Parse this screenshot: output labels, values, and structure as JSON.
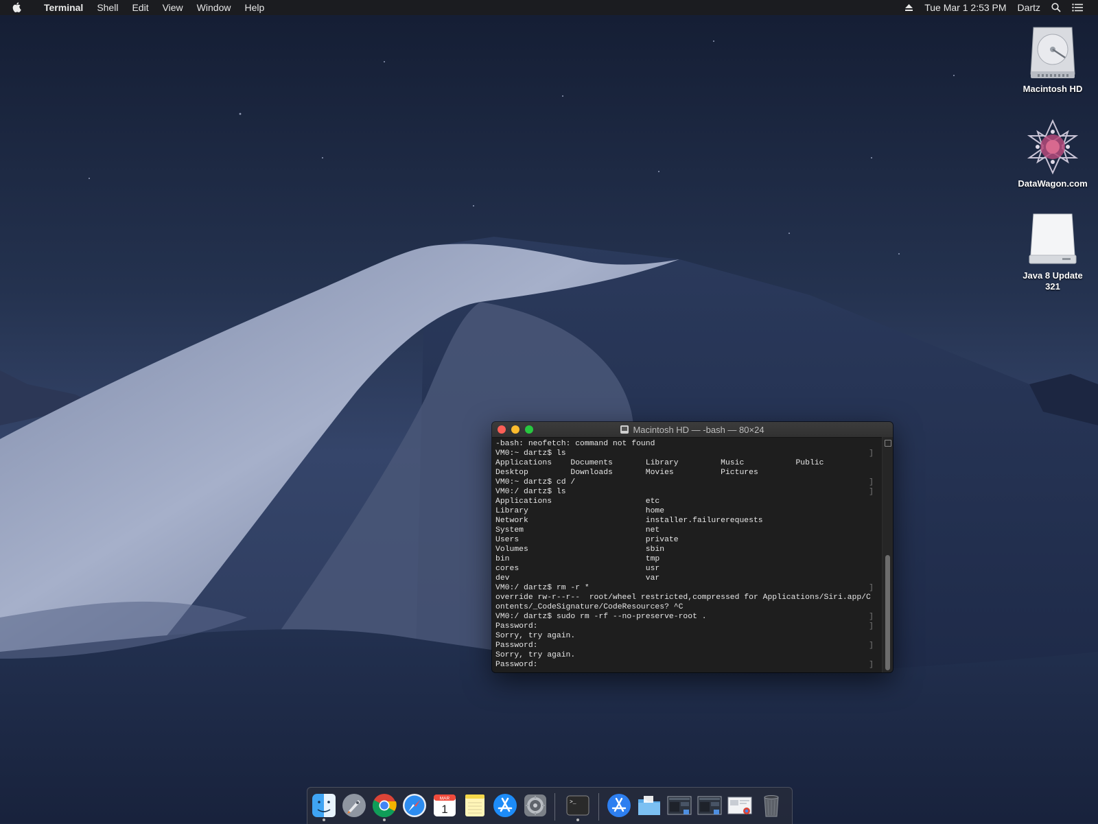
{
  "menubar": {
    "app_name": "Terminal",
    "menus": [
      "Shell",
      "Edit",
      "View",
      "Window",
      "Help"
    ],
    "datetime": "Tue Mar 1  2:53 PM",
    "user": "Dartz",
    "icons": [
      "apple-icon",
      "eject-icon",
      "spotlight-search-icon",
      "notification-center-icon"
    ]
  },
  "desktop": {
    "icons": [
      {
        "label": "Macintosh HD",
        "icon": "hard-drive-icon"
      },
      {
        "label": "DataWagon.com",
        "icon": "datawagon-logo-icon"
      },
      {
        "label": "Java 8 Update 321",
        "label_lines": [
          "Java 8 Update",
          "321"
        ],
        "icon": "disk-image-icon"
      }
    ]
  },
  "terminal": {
    "title": "Macintosh HD — -bash — 80×24",
    "lines": [
      "-bash: neofetch: command not found",
      "VM0:~ dartz$ ls",
      "Applications    Documents       Library         Music           Public",
      "Desktop         Downloads       Movies          Pictures",
      "VM0:~ dartz$ cd /",
      "VM0:/ dartz$ ls",
      "Applications                    etc",
      "Library                         home",
      "Network                         installer.failurerequests",
      "System                          net",
      "Users                           private",
      "Volumes                         sbin",
      "bin                             tmp",
      "cores                           usr",
      "dev                             var",
      "VM0:/ dartz$ rm -r *",
      "override rw-r--r--  root/wheel restricted,compressed for Applications/Siri.app/C",
      "ontents/_CodeSignature/CodeResources? ^C",
      "VM0:/ dartz$ sudo rm -rf --no-preserve-root .",
      "Password:",
      "Sorry, try again.",
      "Password:",
      "Sorry, try again.",
      "Password:"
    ],
    "marked_lines": [
      1,
      4,
      5,
      15,
      18,
      19,
      21,
      23
    ]
  },
  "dock": {
    "items": [
      {
        "name": "Finder",
        "icon": "finder-icon",
        "running": true
      },
      {
        "name": "Launchpad",
        "icon": "launchpad-icon",
        "running": false
      },
      {
        "name": "Google Chrome",
        "icon": "chrome-icon",
        "running": true
      },
      {
        "name": "Safari",
        "icon": "safari-icon",
        "running": false
      },
      {
        "name": "Calendar",
        "icon": "calendar-icon",
        "running": false,
        "month": "MAR",
        "day": "1"
      },
      {
        "name": "Notes",
        "icon": "notes-icon",
        "running": false
      },
      {
        "name": "App Store",
        "icon": "app-store-icon",
        "running": false
      },
      {
        "name": "System Preferences",
        "icon": "system-preferences-icon",
        "running": false
      },
      {
        "name": "Terminal",
        "icon": "terminal-icon",
        "running": true
      },
      {
        "name": "App Store Downloads",
        "icon": "downloads-stack-icon",
        "running": false
      },
      {
        "name": "Documents",
        "icon": "folder-icon",
        "running": false
      },
      {
        "name": "Screenshot",
        "icon": "screenshot-thumbnail-icon",
        "running": false
      },
      {
        "name": "Screenshot",
        "icon": "screenshot-thumbnail-icon",
        "running": false
      },
      {
        "name": "Web Page",
        "icon": "webpage-thumbnail-icon",
        "running": false
      },
      {
        "name": "Trash",
        "icon": "trash-icon",
        "running": false
      }
    ]
  },
  "colors": {
    "sky_top": "#17213a",
    "sky_mid": "#2b3a5e",
    "dune_light": "#9aa6c4",
    "dune_shadow": "#1f2b4a",
    "terminal_bg": "#1e1e1e",
    "close": "#fc5f57",
    "minimize": "#fdbc2e",
    "maximize": "#27c840"
  }
}
